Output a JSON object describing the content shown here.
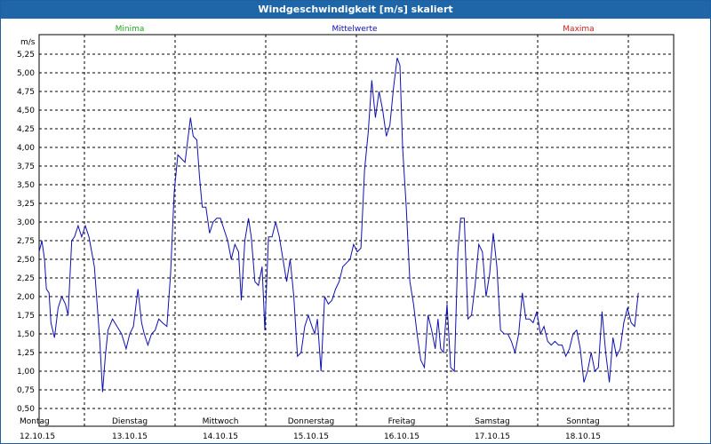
{
  "window": {
    "title": "Windgeschwindigkeit [m/s] skaliert"
  },
  "legend": {
    "min": "Minima",
    "mean": "Mittelwerte",
    "max": "Maxima"
  },
  "colors": {
    "min": "#22aa22",
    "mean": "#1010b0",
    "max": "#cc2020",
    "title_bg": "#1e66a8"
  },
  "chart_data": {
    "type": "line",
    "title": "Windgeschwindigkeit [m/s] skaliert",
    "ylabel": "m/s",
    "ylim": [
      0.5,
      5.25
    ],
    "yticks": [
      "0,50",
      "0,75",
      "1,00",
      "1,25",
      "1,50",
      "1,75",
      "2,00",
      "2,25",
      "2,50",
      "2,75",
      "3,00",
      "3,25",
      "3,50",
      "3,75",
      "4,00",
      "4,25",
      "4,50",
      "4,75",
      "5,00",
      "5,25"
    ],
    "xlim": [
      0,
      7
    ],
    "days": [
      {
        "day": "Montag",
        "date": "12.10.15"
      },
      {
        "day": "Dienstag",
        "date": "13.10.15"
      },
      {
        "day": "Mittwoch",
        "date": "14.10.15"
      },
      {
        "day": "Donnerstag",
        "date": "15.10.15"
      },
      {
        "day": "Freitag",
        "date": "16.10.15"
      },
      {
        "day": "Samstag",
        "date": "17.10.15"
      },
      {
        "day": "Sonntag",
        "date": "18.10.15"
      }
    ],
    "grid": true,
    "series": [
      {
        "name": "Mittelwerte",
        "points": [
          [
            0.0,
            2.6
          ],
          [
            0.03,
            2.75
          ],
          [
            0.06,
            2.5
          ],
          [
            0.08,
            2.1
          ],
          [
            0.11,
            2.05
          ],
          [
            0.13,
            1.65
          ],
          [
            0.17,
            1.45
          ],
          [
            0.21,
            1.85
          ],
          [
            0.25,
            2.0
          ],
          [
            0.29,
            1.9
          ],
          [
            0.32,
            1.75
          ],
          [
            0.36,
            2.75
          ],
          [
            0.39,
            2.8
          ],
          [
            0.43,
            2.95
          ],
          [
            0.47,
            2.8
          ],
          [
            0.51,
            2.95
          ],
          [
            0.55,
            2.8
          ],
          [
            0.58,
            2.6
          ],
          [
            0.61,
            2.4
          ],
          [
            0.64,
            1.9
          ],
          [
            0.67,
            1.4
          ],
          [
            0.7,
            0.72
          ],
          [
            0.73,
            1.2
          ],
          [
            0.76,
            1.55
          ],
          [
            0.81,
            1.7
          ],
          [
            0.86,
            1.6
          ],
          [
            0.91,
            1.5
          ],
          [
            0.96,
            1.3
          ],
          [
            1.0,
            1.5
          ],
          [
            1.04,
            1.6
          ],
          [
            1.09,
            2.1
          ],
          [
            1.13,
            1.65
          ],
          [
            1.16,
            1.5
          ],
          [
            1.2,
            1.35
          ],
          [
            1.24,
            1.5
          ],
          [
            1.28,
            1.55
          ],
          [
            1.32,
            1.7
          ],
          [
            1.36,
            1.65
          ],
          [
            1.41,
            1.6
          ],
          [
            1.45,
            2.3
          ],
          [
            1.49,
            3.4
          ],
          [
            1.53,
            3.9
          ],
          [
            1.57,
            3.85
          ],
          [
            1.61,
            3.8
          ],
          [
            1.65,
            4.2
          ],
          [
            1.67,
            4.4
          ],
          [
            1.7,
            4.15
          ],
          [
            1.74,
            4.1
          ],
          [
            1.77,
            3.6
          ],
          [
            1.8,
            3.2
          ],
          [
            1.84,
            3.2
          ],
          [
            1.88,
            2.85
          ],
          [
            1.92,
            3.0
          ],
          [
            1.96,
            3.05
          ],
          [
            2.0,
            3.05
          ],
          [
            2.04,
            2.9
          ],
          [
            2.08,
            2.75
          ],
          [
            2.12,
            2.5
          ],
          [
            2.16,
            2.7
          ],
          [
            2.2,
            2.6
          ],
          [
            2.23,
            1.95
          ],
          [
            2.27,
            2.75
          ],
          [
            2.31,
            3.05
          ],
          [
            2.34,
            2.8
          ],
          [
            2.38,
            2.2
          ],
          [
            2.42,
            2.15
          ],
          [
            2.46,
            2.4
          ],
          [
            2.49,
            1.55
          ],
          [
            2.53,
            2.8
          ],
          [
            2.57,
            2.8
          ],
          [
            2.61,
            3.0
          ],
          [
            2.65,
            2.8
          ],
          [
            2.69,
            2.5
          ],
          [
            2.73,
            2.2
          ],
          [
            2.77,
            2.5
          ],
          [
            2.81,
            2.0
          ],
          [
            2.85,
            1.2
          ],
          [
            2.89,
            1.25
          ],
          [
            2.93,
            1.6
          ],
          [
            2.97,
            1.75
          ],
          [
            3.01,
            1.6
          ],
          [
            3.04,
            1.5
          ],
          [
            3.07,
            1.7
          ],
          [
            3.11,
            1.0
          ],
          [
            3.15,
            2.0
          ],
          [
            3.19,
            1.9
          ],
          [
            3.23,
            1.95
          ],
          [
            3.27,
            2.1
          ],
          [
            3.31,
            2.2
          ],
          [
            3.35,
            2.4
          ],
          [
            3.39,
            2.45
          ],
          [
            3.43,
            2.5
          ],
          [
            3.47,
            2.7
          ],
          [
            3.51,
            2.6
          ],
          [
            3.55,
            2.65
          ],
          [
            3.59,
            3.7
          ],
          [
            3.63,
            4.2
          ],
          [
            3.67,
            4.9
          ],
          [
            3.71,
            4.4
          ],
          [
            3.75,
            4.75
          ],
          [
            3.79,
            4.5
          ],
          [
            3.83,
            4.15
          ],
          [
            3.87,
            4.3
          ],
          [
            3.91,
            4.8
          ],
          [
            3.95,
            5.2
          ],
          [
            3.98,
            5.1
          ],
          [
            4.01,
            4.0
          ],
          [
            4.05,
            3.2
          ],
          [
            4.09,
            2.2
          ],
          [
            4.13,
            1.9
          ],
          [
            4.17,
            1.5
          ],
          [
            4.21,
            1.15
          ],
          [
            4.25,
            1.05
          ],
          [
            4.29,
            1.75
          ],
          [
            4.33,
            1.55
          ],
          [
            4.37,
            1.3
          ],
          [
            4.4,
            1.7
          ],
          [
            4.43,
            1.3
          ],
          [
            4.46,
            1.25
          ],
          [
            4.5,
            1.9
          ],
          [
            4.54,
            1.05
          ],
          [
            4.58,
            1.0
          ],
          [
            4.62,
            2.6
          ],
          [
            4.65,
            3.05
          ],
          [
            4.69,
            3.05
          ],
          [
            4.73,
            1.7
          ],
          [
            4.77,
            1.75
          ],
          [
            4.81,
            2.15
          ],
          [
            4.85,
            2.7
          ],
          [
            4.89,
            2.6
          ],
          [
            4.93,
            2.0
          ],
          [
            4.97,
            2.3
          ],
          [
            5.01,
            2.85
          ],
          [
            5.05,
            2.4
          ],
          [
            5.09,
            1.55
          ],
          [
            5.13,
            1.5
          ],
          [
            5.17,
            1.5
          ],
          [
            5.21,
            1.4
          ],
          [
            5.25,
            1.25
          ],
          [
            5.29,
            1.5
          ],
          [
            5.33,
            2.05
          ],
          [
            5.37,
            1.7
          ],
          [
            5.41,
            1.7
          ],
          [
            5.45,
            1.65
          ],
          [
            5.49,
            1.8
          ],
          [
            5.53,
            1.5
          ],
          [
            5.57,
            1.6
          ],
          [
            5.61,
            1.4
          ],
          [
            5.65,
            1.35
          ],
          [
            5.69,
            1.4
          ],
          [
            5.73,
            1.35
          ],
          [
            5.77,
            1.35
          ],
          [
            5.81,
            1.2
          ],
          [
            5.85,
            1.3
          ],
          [
            5.89,
            1.5
          ],
          [
            5.93,
            1.55
          ],
          [
            5.97,
            1.3
          ],
          [
            6.01,
            0.85
          ],
          [
            6.05,
            1.0
          ],
          [
            6.09,
            1.25
          ],
          [
            6.13,
            1.0
          ],
          [
            6.17,
            1.05
          ],
          [
            6.21,
            1.8
          ],
          [
            6.25,
            1.25
          ],
          [
            6.29,
            0.85
          ],
          [
            6.33,
            1.45
          ],
          [
            6.37,
            1.2
          ],
          [
            6.41,
            1.3
          ],
          [
            6.45,
            1.65
          ],
          [
            6.49,
            1.85
          ],
          [
            6.53,
            1.65
          ],
          [
            6.57,
            1.6
          ],
          [
            6.61,
            2.05
          ]
        ]
      }
    ]
  }
}
